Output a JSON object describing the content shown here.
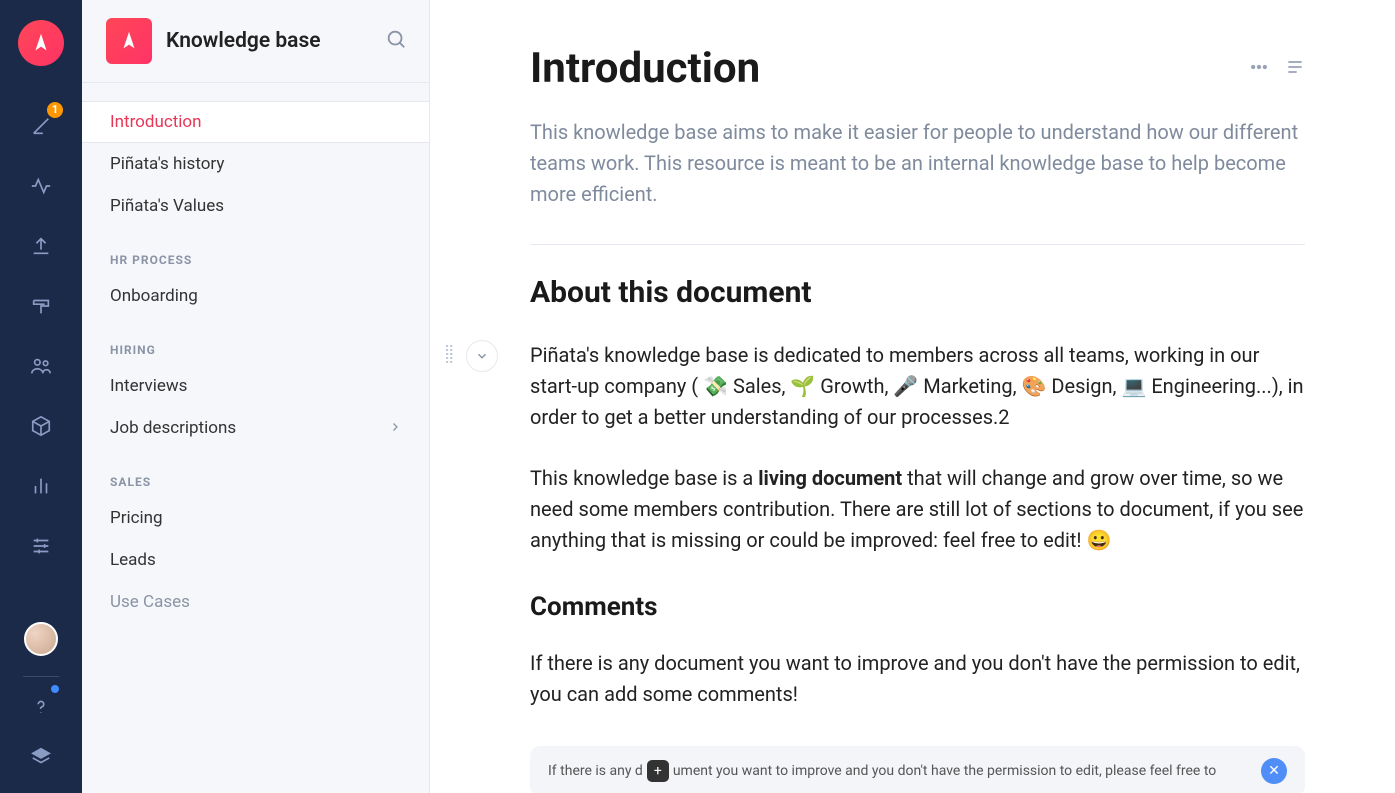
{
  "rail": {
    "badge_count": "1"
  },
  "sidebar": {
    "title": "Knowledge base",
    "items": [
      {
        "label": "Introduction",
        "active": true
      },
      {
        "label": "Piñata's history"
      },
      {
        "label": "Piñata's Values"
      }
    ],
    "sections": [
      {
        "heading": "HR PROCESS",
        "items": [
          {
            "label": "Onboarding"
          }
        ]
      },
      {
        "heading": "HIRING",
        "items": [
          {
            "label": "Interviews"
          },
          {
            "label": "Job descriptions",
            "chevron": true
          }
        ]
      },
      {
        "heading": "SALES",
        "items": [
          {
            "label": "Pricing"
          },
          {
            "label": "Leads"
          },
          {
            "label": "Use Cases",
            "muted": true
          }
        ]
      }
    ]
  },
  "doc": {
    "title": "Introduction",
    "intro": "This knowledge base aims to make it easier for people to understand how our different teams work. This resource is meant to be an internal knowledge base to help become more efficient.",
    "h2": "About this document",
    "p1_prefix": "Piñata's knowledge base is dedicated to members across all teams, working in our start-up company ( ",
    "p1_sales": "💸  Sales, ",
    "p1_growth": "🌱  Growth, ",
    "p1_marketing": "🎤  Marketing, ",
    "p1_design": "🎨  Design, ",
    "p1_engineering": "💻  Engineering...), in order to get a better understanding of our processes.2",
    "p2_prefix": "This knowledge base is a ",
    "p2_bold": "living document",
    "p2_suffix": " that will change and grow over time, so we need some members contribution. There are still lot of sections to document, if you see anything that is missing or could be improved: feel free to edit! 😀",
    "h3": "Comments",
    "p3": "If there is any document you want to improve and you don't have the permission to edit, you can add some comments!",
    "callout_prefix": "If there is any d",
    "callout_mid": "ument you want to improve and you don't have the permission to edit, please feel free to"
  }
}
